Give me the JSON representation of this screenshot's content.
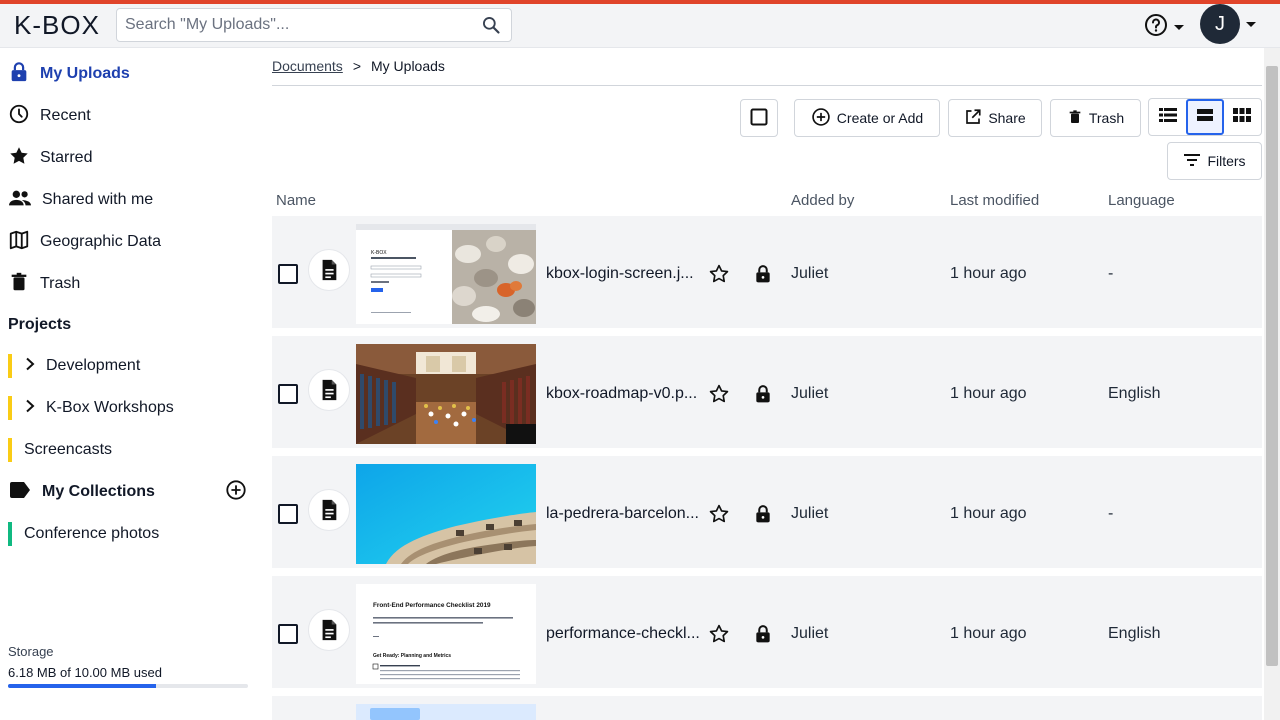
{
  "app": {
    "logo": "K-BOX"
  },
  "search": {
    "placeholder": "Search \"My Uploads\"..."
  },
  "header": {
    "user_initial": "J"
  },
  "sidebar": {
    "items": [
      {
        "label": "My Uploads",
        "icon": "lock-icon",
        "active": true
      },
      {
        "label": "Recent",
        "icon": "clock-icon"
      },
      {
        "label": "Starred",
        "icon": "star-icon"
      },
      {
        "label": "Shared with me",
        "icon": "people-icon"
      },
      {
        "label": "Geographic Data",
        "icon": "map-icon"
      },
      {
        "label": "Trash",
        "icon": "trash-icon"
      }
    ],
    "projects_title": "Projects",
    "projects": [
      {
        "label": "Development",
        "color": "#facc15"
      },
      {
        "label": "K-Box Workshops",
        "color": "#facc15"
      },
      {
        "label": "Screencasts",
        "color": "#facc15"
      }
    ],
    "collections_title": "My Collections",
    "collections": [
      {
        "label": "Conference photos",
        "color": "#10b981"
      }
    ],
    "storage": {
      "label": "Storage",
      "value": "6.18 MB of 10.00 MB used",
      "fraction": 0.618
    }
  },
  "breadcrumb": {
    "root": "Documents",
    "separator": ">",
    "current": "My Uploads"
  },
  "toolbar": {
    "create_label": "Create or Add",
    "share_label": "Share",
    "trash_label": "Trash",
    "filters_label": "Filters"
  },
  "table": {
    "columns": {
      "name": "Name",
      "added_by": "Added by",
      "last_modified": "Last modified",
      "language": "Language"
    },
    "rows": [
      {
        "name": "kbox-login-screen.j...",
        "added_by": "Juliet",
        "modified": "1 hour ago",
        "language": "-"
      },
      {
        "name": "kbox-roadmap-v0.p...",
        "added_by": "Juliet",
        "modified": "1 hour ago",
        "language": "English"
      },
      {
        "name": "la-pedrera-barcelon...",
        "added_by": "Juliet",
        "modified": "1 hour ago",
        "language": "-"
      },
      {
        "name": "performance-checkl...",
        "added_by": "Juliet",
        "modified": "1 hour ago",
        "language": "English"
      }
    ]
  },
  "thumbs": {
    "login_title": "K-BOX",
    "checklist_title": "Front-End Performance Checklist 2019",
    "checklist_heading": "Get Ready: Planning and Metrics"
  },
  "colors": {
    "accent": "#e0442a",
    "active": "#1e40af",
    "primary": "#2563eb"
  }
}
